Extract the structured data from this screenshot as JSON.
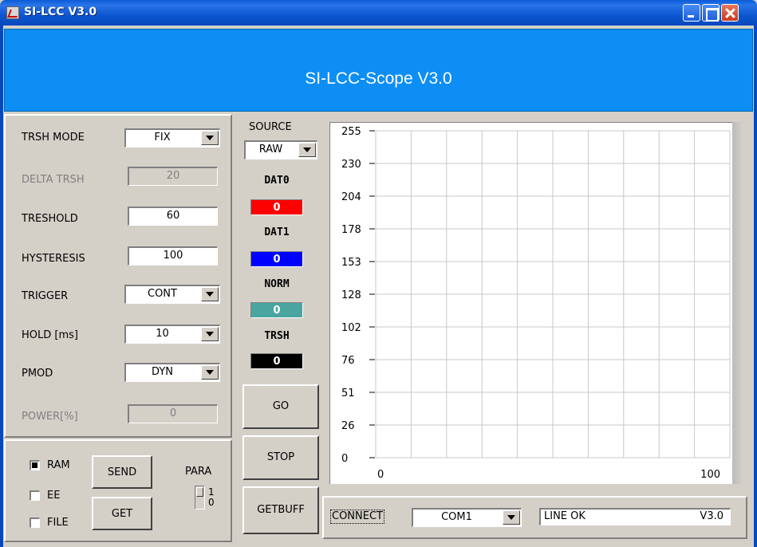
{
  "window": {
    "title": "SI-LCC V3.0"
  },
  "header": {
    "title": "SI-LCC-Scope V3.0"
  },
  "settings": {
    "trsh_mode": {
      "label": "TRSH MODE",
      "value": "FIX"
    },
    "delta_trsh": {
      "label": "DELTA TRSH",
      "value": "20"
    },
    "treshold": {
      "label": "TRESHOLD",
      "value": "60"
    },
    "hysteresis": {
      "label": "HYSTERESIS",
      "value": "100"
    },
    "trigger": {
      "label": "TRIGGER",
      "value": "CONT"
    },
    "hold": {
      "label": "HOLD [ms]",
      "value": "10"
    },
    "pmod": {
      "label": "PMOD",
      "value": "DYN"
    },
    "power": {
      "label": "POWER[%]",
      "value": "0"
    }
  },
  "memory": {
    "ram": {
      "label": "RAM",
      "checked": true
    },
    "ee": {
      "label": "EE",
      "checked": false
    },
    "file": {
      "label": "FILE",
      "checked": false
    },
    "send_label": "SEND",
    "get_label": "GET",
    "para_label": "PARA",
    "para_high": "1",
    "para_low": "0"
  },
  "source": {
    "label": "SOURCE",
    "value": "RAW"
  },
  "indicators": [
    {
      "label": "DAT0",
      "value": "0",
      "color": "#ff0000"
    },
    {
      "label": "DAT1",
      "value": "0",
      "color": "#0000ff"
    },
    {
      "label": "NORM",
      "value": "0",
      "color": "#4aa5a0"
    },
    {
      "label": "TRSH",
      "value": "0",
      "color": "#000000"
    }
  ],
  "buttons": {
    "go": "GO",
    "stop": "STOP",
    "getbuff": "GETBUFF"
  },
  "chart_data": {
    "type": "line",
    "y_ticks": [
      "255",
      "230",
      "204",
      "178",
      "153",
      "128",
      "102",
      "76",
      "51",
      "26",
      "0"
    ],
    "x_ticks": [
      "0",
      "100"
    ],
    "xlim": [
      0,
      100
    ],
    "ylim": [
      0,
      255
    ],
    "grid": true,
    "series": []
  },
  "status": {
    "connect_label": "CONNECT",
    "port": "COM1",
    "line_status": "LINE OK",
    "version": "V3.0"
  }
}
